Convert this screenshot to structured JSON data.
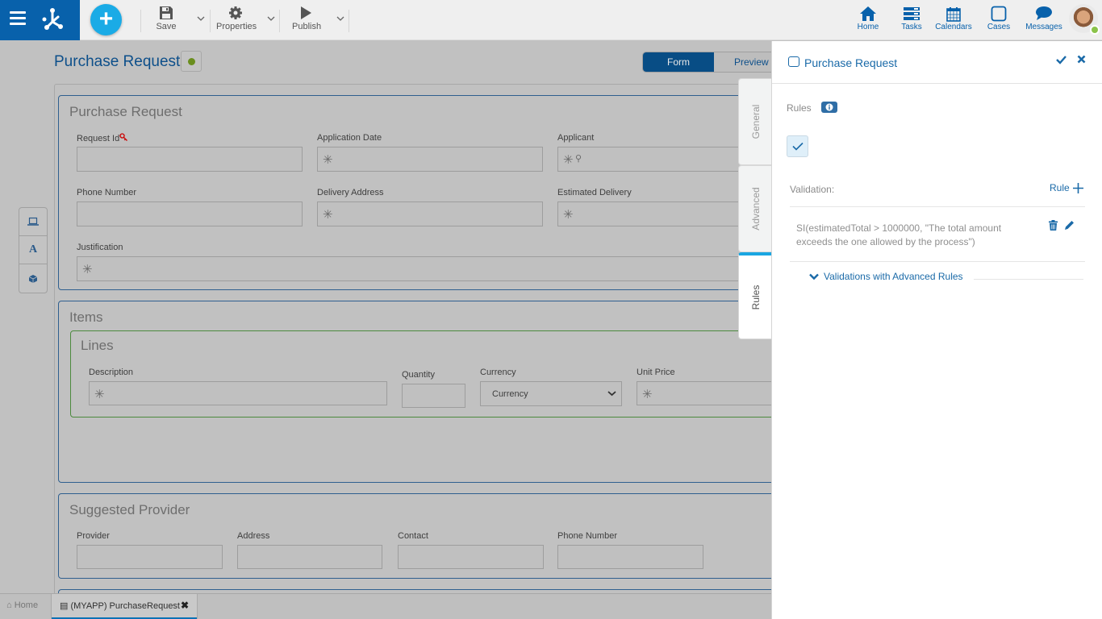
{
  "toolbar": {
    "save_label": "Save",
    "properties_label": "Properties",
    "publish_label": "Publish",
    "nav": [
      {
        "label": "Home",
        "icon": "home-icon"
      },
      {
        "label": "Tasks",
        "icon": "tasks-icon"
      },
      {
        "label": "Calendars",
        "icon": "calendar-icon"
      },
      {
        "label": "Cases",
        "icon": "cases-icon"
      },
      {
        "label": "Messages",
        "icon": "messages-icon"
      }
    ],
    "add_symbol": "+"
  },
  "page": {
    "title": "Purchase Request",
    "view_toggle": {
      "form": "Form",
      "preview": "Preview",
      "selected": "Form"
    }
  },
  "form": {
    "purchase_request": {
      "title": "Purchase Request",
      "fields": {
        "request_id": "Request Id",
        "application_date": "Application Date",
        "applicant": "Applicant",
        "phone_number": "Phone Number",
        "delivery_address": "Delivery Address",
        "estimated_delivery": "Estimated Delivery",
        "justification": "Justification"
      }
    },
    "items": {
      "title": "Items",
      "lines_title": "Lines",
      "fields": {
        "description": "Description",
        "quantity": "Quantity",
        "currency": "Currency",
        "currency_value": "Currency",
        "unit_price": "Unit Price"
      }
    },
    "suggested_provider": {
      "title": "Suggested Provider",
      "fields": {
        "provider": "Provider",
        "address": "Address",
        "contact": "Contact",
        "phone_number": "Phone Number"
      }
    },
    "required_marker": "✳"
  },
  "bottom_tabs": {
    "home": "Home",
    "active": "(MYAPP) PurchaseRequest"
  },
  "vertical_tabs": [
    {
      "label": "General",
      "active": false
    },
    {
      "label": "Advanced",
      "active": false
    },
    {
      "label": "Rules",
      "active": true
    }
  ],
  "panel": {
    "title": "Purchase Request",
    "rules_label": "Rules",
    "validation_label": "Validation:",
    "add_rule_label": "Rule",
    "rule_expression": "SI(estimatedTotal > 1000000, \"The total amount exceeds the one allowed by the process\")",
    "advanced_label": "Validations with Advanced Rules"
  },
  "colors": {
    "brand": "#0861ab",
    "accent": "#1aabe6",
    "link": "#1a6aa8",
    "status_green": "#6a8e1e"
  }
}
